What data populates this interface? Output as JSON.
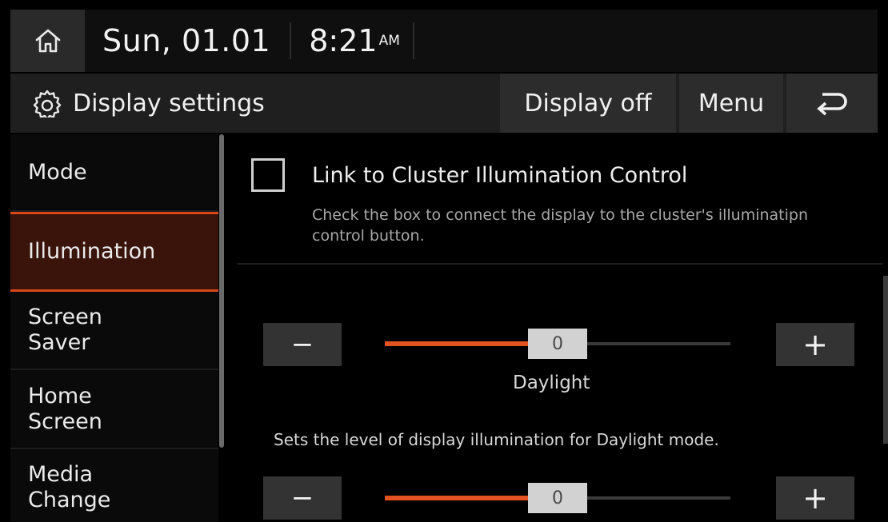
{
  "status_bar": {
    "home_icon": "home-icon",
    "date": "Sun, 01.01",
    "time": "8:21",
    "ampm": "AM"
  },
  "header": {
    "settings_icon": "gear-icon",
    "title": "Display settings",
    "display_off_label": "Display off",
    "menu_label": "Menu",
    "back_icon": "back-arrow-icon"
  },
  "sidebar": {
    "items": [
      {
        "label": "Mode"
      },
      {
        "label": "Illumination"
      },
      {
        "label": "Screen\nSaver"
      },
      {
        "label": "Home\nScreen"
      },
      {
        "label": "Media\nChange"
      }
    ],
    "active_index": 1
  },
  "content": {
    "link_cluster": {
      "label": "Link to Cluster Illumination Control",
      "checked": false,
      "description": "Check the box to connect the display to the cluster's illuminatipn control button."
    },
    "daylight_slider": {
      "value": "0",
      "level_fraction": 0.5,
      "mode_label": "Daylight",
      "description": "Sets the level of display illumination for Daylight mode.",
      "minus_label": "−",
      "plus_label": "+"
    },
    "second_slider": {
      "value": "0",
      "level_fraction": 0.5,
      "minus_label": "−",
      "plus_label": "+"
    }
  },
  "colors": {
    "accent": "#e2541f",
    "active_bg": "#3a140a",
    "header_bg": "#1f1f1f"
  }
}
